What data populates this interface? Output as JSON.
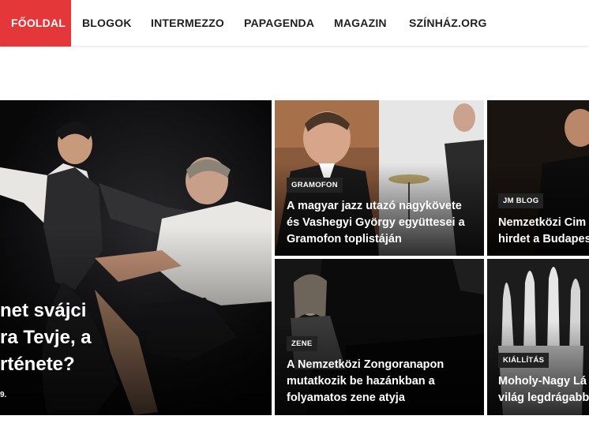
{
  "nav": {
    "items": [
      {
        "label": "FŐOLDAL",
        "active": true
      },
      {
        "label": "BLOGOK"
      },
      {
        "label": "INTERMEZZO"
      },
      {
        "label": "PAPAGENDA"
      },
      {
        "label": "MAGAZIN"
      },
      {
        "label": "SZÍNHÁZ.ORG"
      }
    ],
    "active_color": "#e3373a"
  },
  "featured": {
    "title_lines": [
      "net svájci",
      "ra Tevje, a",
      "rténete?"
    ],
    "date_fragment": "9."
  },
  "tiles": [
    {
      "category": "GRAMOFON",
      "title_lines": [
        "A magyar jazz utazó nagykövete",
        "és Vashegyi György együttesei a",
        "Gramofon toplistáján"
      ]
    },
    {
      "category": "JM BLOG",
      "title_lines": [
        "Nemzetközi Cim",
        "hirdet a Budapes"
      ]
    },
    {
      "category": "ZENE",
      "title_lines": [
        "A Nemzetközi Zongoranapon",
        "mutatkozik be hazánkban a",
        "folyamatos zene atyja"
      ]
    },
    {
      "category": "KIÁLLÍTÁS",
      "title_lines": [
        "Moholy-Nagy Lá",
        "világ legdrágabb"
      ]
    }
  ]
}
